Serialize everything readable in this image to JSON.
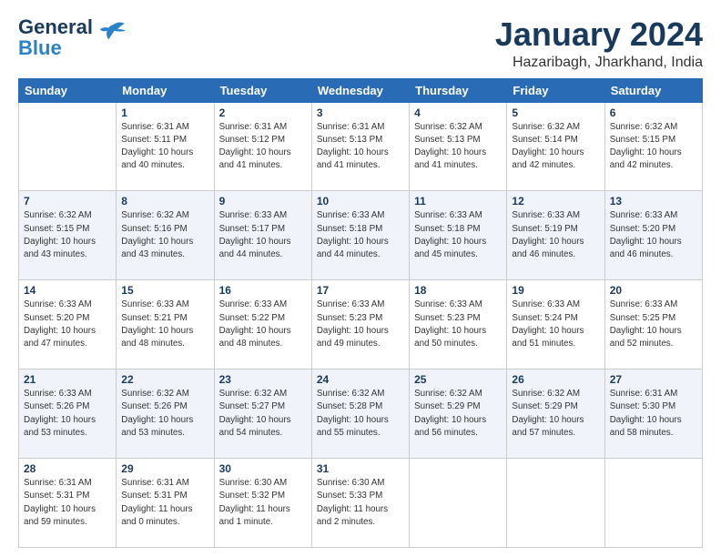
{
  "header": {
    "logo_line1": "General",
    "logo_line2": "Blue",
    "month": "January 2024",
    "location": "Hazaribagh, Jharkhand, India"
  },
  "days_of_week": [
    "Sunday",
    "Monday",
    "Tuesday",
    "Wednesday",
    "Thursday",
    "Friday",
    "Saturday"
  ],
  "weeks": [
    [
      {
        "day": "",
        "info": ""
      },
      {
        "day": "1",
        "info": "Sunrise: 6:31 AM\nSunset: 5:11 PM\nDaylight: 10 hours\nand 40 minutes."
      },
      {
        "day": "2",
        "info": "Sunrise: 6:31 AM\nSunset: 5:12 PM\nDaylight: 10 hours\nand 41 minutes."
      },
      {
        "day": "3",
        "info": "Sunrise: 6:31 AM\nSunset: 5:13 PM\nDaylight: 10 hours\nand 41 minutes."
      },
      {
        "day": "4",
        "info": "Sunrise: 6:32 AM\nSunset: 5:13 PM\nDaylight: 10 hours\nand 41 minutes."
      },
      {
        "day": "5",
        "info": "Sunrise: 6:32 AM\nSunset: 5:14 PM\nDaylight: 10 hours\nand 42 minutes."
      },
      {
        "day": "6",
        "info": "Sunrise: 6:32 AM\nSunset: 5:15 PM\nDaylight: 10 hours\nand 42 minutes."
      }
    ],
    [
      {
        "day": "7",
        "info": "Sunrise: 6:32 AM\nSunset: 5:15 PM\nDaylight: 10 hours\nand 43 minutes."
      },
      {
        "day": "8",
        "info": "Sunrise: 6:32 AM\nSunset: 5:16 PM\nDaylight: 10 hours\nand 43 minutes."
      },
      {
        "day": "9",
        "info": "Sunrise: 6:33 AM\nSunset: 5:17 PM\nDaylight: 10 hours\nand 44 minutes."
      },
      {
        "day": "10",
        "info": "Sunrise: 6:33 AM\nSunset: 5:18 PM\nDaylight: 10 hours\nand 44 minutes."
      },
      {
        "day": "11",
        "info": "Sunrise: 6:33 AM\nSunset: 5:18 PM\nDaylight: 10 hours\nand 45 minutes."
      },
      {
        "day": "12",
        "info": "Sunrise: 6:33 AM\nSunset: 5:19 PM\nDaylight: 10 hours\nand 46 minutes."
      },
      {
        "day": "13",
        "info": "Sunrise: 6:33 AM\nSunset: 5:20 PM\nDaylight: 10 hours\nand 46 minutes."
      }
    ],
    [
      {
        "day": "14",
        "info": "Sunrise: 6:33 AM\nSunset: 5:20 PM\nDaylight: 10 hours\nand 47 minutes."
      },
      {
        "day": "15",
        "info": "Sunrise: 6:33 AM\nSunset: 5:21 PM\nDaylight: 10 hours\nand 48 minutes."
      },
      {
        "day": "16",
        "info": "Sunrise: 6:33 AM\nSunset: 5:22 PM\nDaylight: 10 hours\nand 48 minutes."
      },
      {
        "day": "17",
        "info": "Sunrise: 6:33 AM\nSunset: 5:23 PM\nDaylight: 10 hours\nand 49 minutes."
      },
      {
        "day": "18",
        "info": "Sunrise: 6:33 AM\nSunset: 5:23 PM\nDaylight: 10 hours\nand 50 minutes."
      },
      {
        "day": "19",
        "info": "Sunrise: 6:33 AM\nSunset: 5:24 PM\nDaylight: 10 hours\nand 51 minutes."
      },
      {
        "day": "20",
        "info": "Sunrise: 6:33 AM\nSunset: 5:25 PM\nDaylight: 10 hours\nand 52 minutes."
      }
    ],
    [
      {
        "day": "21",
        "info": "Sunrise: 6:33 AM\nSunset: 5:26 PM\nDaylight: 10 hours\nand 53 minutes."
      },
      {
        "day": "22",
        "info": "Sunrise: 6:32 AM\nSunset: 5:26 PM\nDaylight: 10 hours\nand 53 minutes."
      },
      {
        "day": "23",
        "info": "Sunrise: 6:32 AM\nSunset: 5:27 PM\nDaylight: 10 hours\nand 54 minutes."
      },
      {
        "day": "24",
        "info": "Sunrise: 6:32 AM\nSunset: 5:28 PM\nDaylight: 10 hours\nand 55 minutes."
      },
      {
        "day": "25",
        "info": "Sunrise: 6:32 AM\nSunset: 5:29 PM\nDaylight: 10 hours\nand 56 minutes."
      },
      {
        "day": "26",
        "info": "Sunrise: 6:32 AM\nSunset: 5:29 PM\nDaylight: 10 hours\nand 57 minutes."
      },
      {
        "day": "27",
        "info": "Sunrise: 6:31 AM\nSunset: 5:30 PM\nDaylight: 10 hours\nand 58 minutes."
      }
    ],
    [
      {
        "day": "28",
        "info": "Sunrise: 6:31 AM\nSunset: 5:31 PM\nDaylight: 10 hours\nand 59 minutes."
      },
      {
        "day": "29",
        "info": "Sunrise: 6:31 AM\nSunset: 5:31 PM\nDaylight: 11 hours\nand 0 minutes."
      },
      {
        "day": "30",
        "info": "Sunrise: 6:30 AM\nSunset: 5:32 PM\nDaylight: 11 hours\nand 1 minute."
      },
      {
        "day": "31",
        "info": "Sunrise: 6:30 AM\nSunset: 5:33 PM\nDaylight: 11 hours\nand 2 minutes."
      },
      {
        "day": "",
        "info": ""
      },
      {
        "day": "",
        "info": ""
      },
      {
        "day": "",
        "info": ""
      }
    ]
  ]
}
